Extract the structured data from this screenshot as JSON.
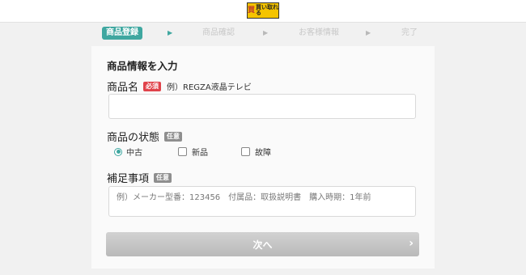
{
  "header": {
    "logo_mark": "買",
    "logo_text": "買い取れる"
  },
  "steps": [
    {
      "label": "商品登録"
    },
    {
      "label": "商品確認"
    },
    {
      "label": "お客様情報"
    },
    {
      "label": "完了"
    }
  ],
  "step_arrow": "▶",
  "form": {
    "section_title": "商品情報を入力",
    "product_name": {
      "label": "商品名",
      "badge": "必須",
      "example": "例）REGZA液晶テレビ",
      "value": ""
    },
    "condition": {
      "label": "商品の状態",
      "badge": "任意",
      "options": [
        {
          "label": "中古",
          "selected": true
        },
        {
          "label": "新品",
          "selected": false
        },
        {
          "label": "故障",
          "selected": false
        }
      ]
    },
    "notes": {
      "label": "補足事項",
      "badge": "任意",
      "placeholder": "例）メーカー型番：123456　付属品：取扱説明書　購入時期：1年前"
    }
  },
  "next_button": {
    "label": "次へ",
    "chevron": "›"
  },
  "colors": {
    "accent": "#3fa7a0",
    "required": "#e0434b",
    "optional": "#8e8e8e"
  }
}
